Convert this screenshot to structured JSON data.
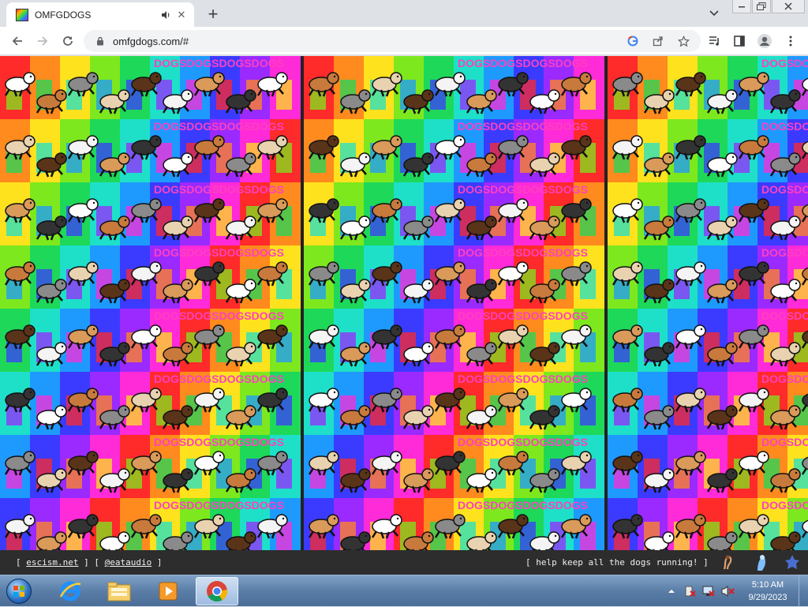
{
  "browser": {
    "tab_title": "OMFGDOGS",
    "url": "omfgdogs.com/#",
    "new_tab_symbol": "+",
    "close_symbol": "✕"
  },
  "page": {
    "footer": {
      "left_open": "[ ",
      "link1": "escism.net",
      "sep": " ] [ ",
      "link2": "@eataudio",
      "left_close": " ]",
      "right": "[ help keep all the dogs running! ]"
    },
    "pattern_word": "DOGS",
    "rainbow_colors": [
      "#ff2a2a",
      "#ff8a1e",
      "#ffe21e",
      "#7ee81e",
      "#1ed85a",
      "#1ee0c8",
      "#1e9aff",
      "#3b3bff",
      "#9a2aff",
      "#ff2ad8"
    ]
  },
  "taskbar": {
    "clock_time": "5:10 AM",
    "clock_date": "9/29/2023"
  },
  "icons": [
    "speaker-icon",
    "close-icon",
    "plus-icon",
    "chevron-down-icon",
    "back-icon",
    "forward-icon",
    "reload-icon",
    "lock-icon",
    "google-icon",
    "share-icon",
    "star-icon",
    "media-icon",
    "sidepanel-icon",
    "profile-icon",
    "menu-icon"
  ]
}
